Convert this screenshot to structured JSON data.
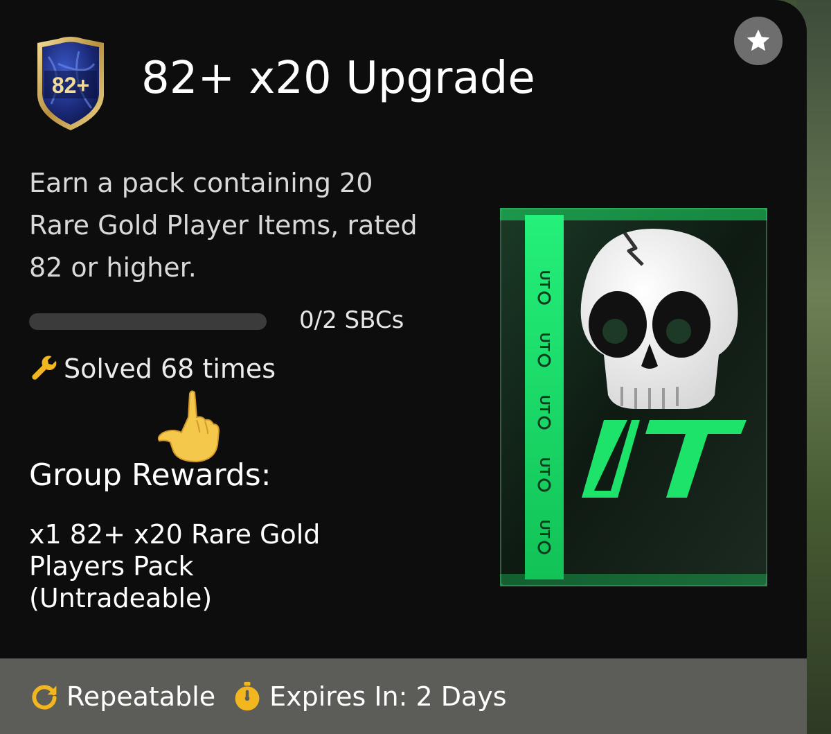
{
  "sbc": {
    "badge_label": "82+",
    "title": "82+ x20 Upgrade",
    "description": "Earn a pack containing 20 Rare Gold Player Items, rated 82 or higher.",
    "progress": {
      "completed": 0,
      "total": 2,
      "text": "0/2 SBCs"
    },
    "solved_text": "Solved 68 times",
    "rewards_heading": "Group Rewards:",
    "reward_item": "x1 82+ x20 Rare Gold Players Pack (Untradeable)",
    "pack_logo": "UT"
  },
  "footer": {
    "repeatable_label": "Repeatable",
    "expires_label": "Expires In: 2 Days"
  },
  "icons": {
    "favorite": "star-icon",
    "solved": "wrench-icon",
    "pointer": "pointing-hand-icon",
    "repeatable": "refresh-icon",
    "expires": "stopwatch-icon"
  },
  "colors": {
    "card_background": "#0d0d0d",
    "footer_background": "#5c5c58",
    "accent_gold": "#e8c43a",
    "pack_green": "#1ee36a"
  }
}
